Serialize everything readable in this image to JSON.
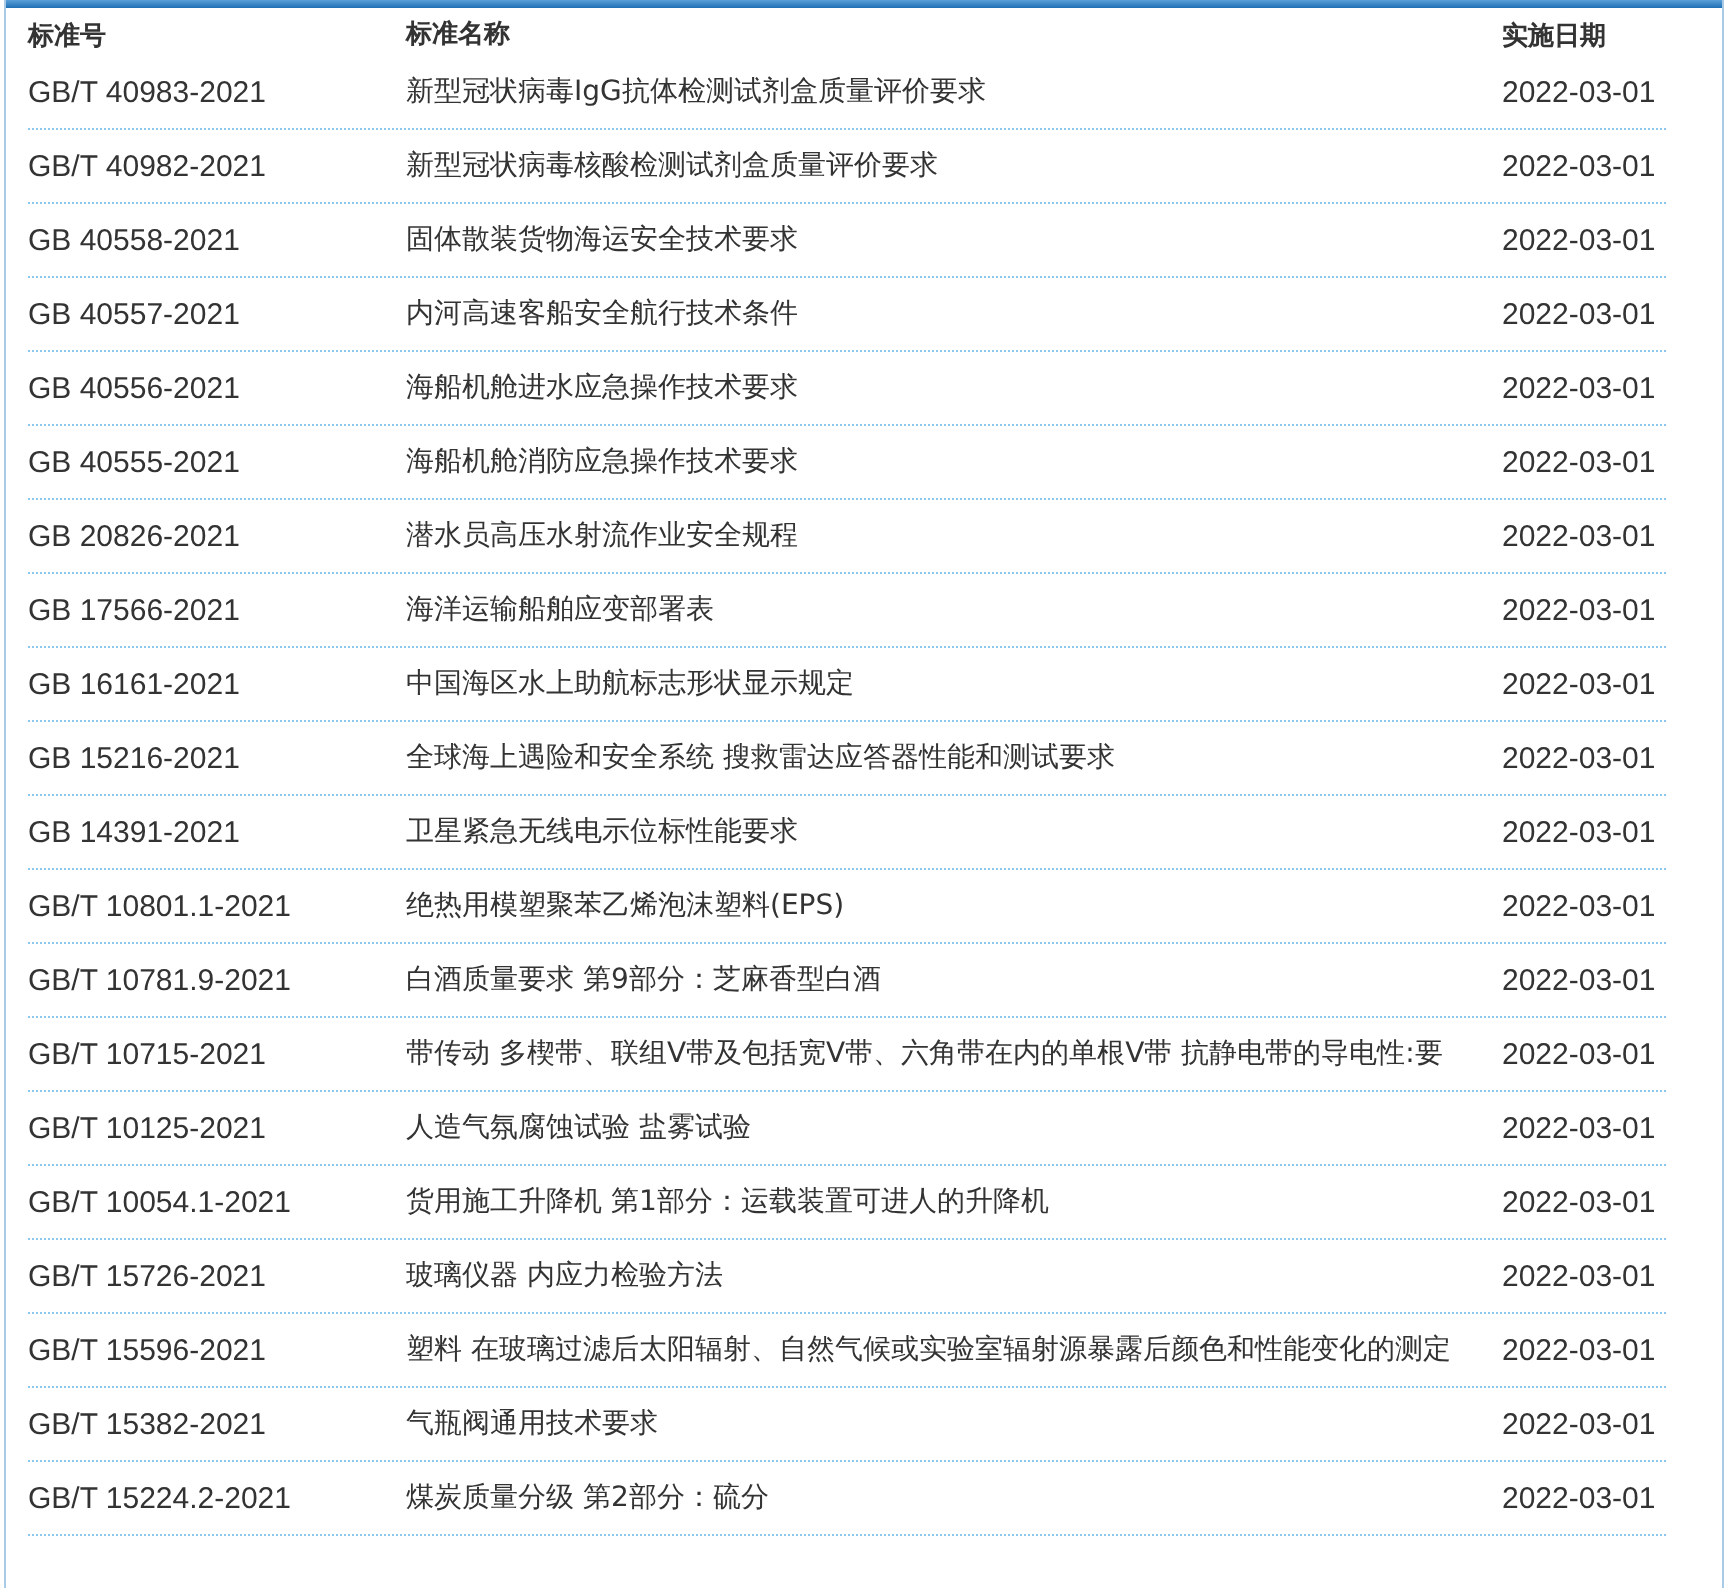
{
  "table": {
    "columns": [
      "标准号",
      "标准名称",
      "实施日期"
    ],
    "rows": [
      {
        "code": "GB/T 40983-2021",
        "name": "新型冠状病毒IgG抗体检测试剂盒质量评价要求",
        "date": "2022-03-01"
      },
      {
        "code": "GB/T 40982-2021",
        "name": "新型冠状病毒核酸检测试剂盒质量评价要求",
        "date": "2022-03-01"
      },
      {
        "code": "GB 40558-2021",
        "name": "固体散装货物海运安全技术要求",
        "date": "2022-03-01"
      },
      {
        "code": "GB 40557-2021",
        "name": "内河高速客船安全航行技术条件",
        "date": "2022-03-01"
      },
      {
        "code": "GB 40556-2021",
        "name": "海船机舱进水应急操作技术要求",
        "date": "2022-03-01"
      },
      {
        "code": "GB 40555-2021",
        "name": "海船机舱消防应急操作技术要求",
        "date": "2022-03-01"
      },
      {
        "code": "GB 20826-2021",
        "name": "潜水员高压水射流作业安全规程",
        "date": "2022-03-01"
      },
      {
        "code": "GB 17566-2021",
        "name": "海洋运输船舶应变部署表",
        "date": "2022-03-01"
      },
      {
        "code": "GB 16161-2021",
        "name": "中国海区水上助航标志形状显示规定",
        "date": "2022-03-01"
      },
      {
        "code": "GB 15216-2021",
        "name": "全球海上遇险和安全系统 搜救雷达应答器性能和测试要求",
        "date": "2022-03-01"
      },
      {
        "code": "GB 14391-2021",
        "name": "卫星紧急无线电示位标性能要求",
        "date": "2022-03-01"
      },
      {
        "code": "GB/T 10801.1-2021",
        "name": "绝热用模塑聚苯乙烯泡沫塑料(EPS)",
        "date": "2022-03-01"
      },
      {
        "code": "GB/T 10781.9-2021",
        "name": "白酒质量要求 第9部分：芝麻香型白酒",
        "date": "2022-03-01"
      },
      {
        "code": "GB/T 10715-2021",
        "name": "带传动 多楔带、联组V带及包括宽V带、六角带在内的单根V带 抗静电带的导电性:要",
        "date": "2022-03-01"
      },
      {
        "code": "GB/T 10125-2021",
        "name": "人造气氛腐蚀试验 盐雾试验",
        "date": "2022-03-01"
      },
      {
        "code": "GB/T 10054.1-2021",
        "name": "货用施工升降机 第1部分：运载装置可进人的升降机",
        "date": "2022-03-01"
      },
      {
        "code": "GB/T 15726-2021",
        "name": "玻璃仪器 内应力检验方法",
        "date": "2022-03-01"
      },
      {
        "code": "GB/T 15596-2021",
        "name": "塑料 在玻璃过滤后太阳辐射、自然气候或实验室辐射源暴露后颜色和性能变化的测定",
        "date": "2022-03-01"
      },
      {
        "code": "GB/T 15382-2021",
        "name": "气瓶阀通用技术要求",
        "date": "2022-03-01"
      },
      {
        "code": "GB/T 15224.2-2021",
        "name": "煤炭质量分级 第2部分：硫分",
        "date": "2022-03-01"
      }
    ]
  }
}
